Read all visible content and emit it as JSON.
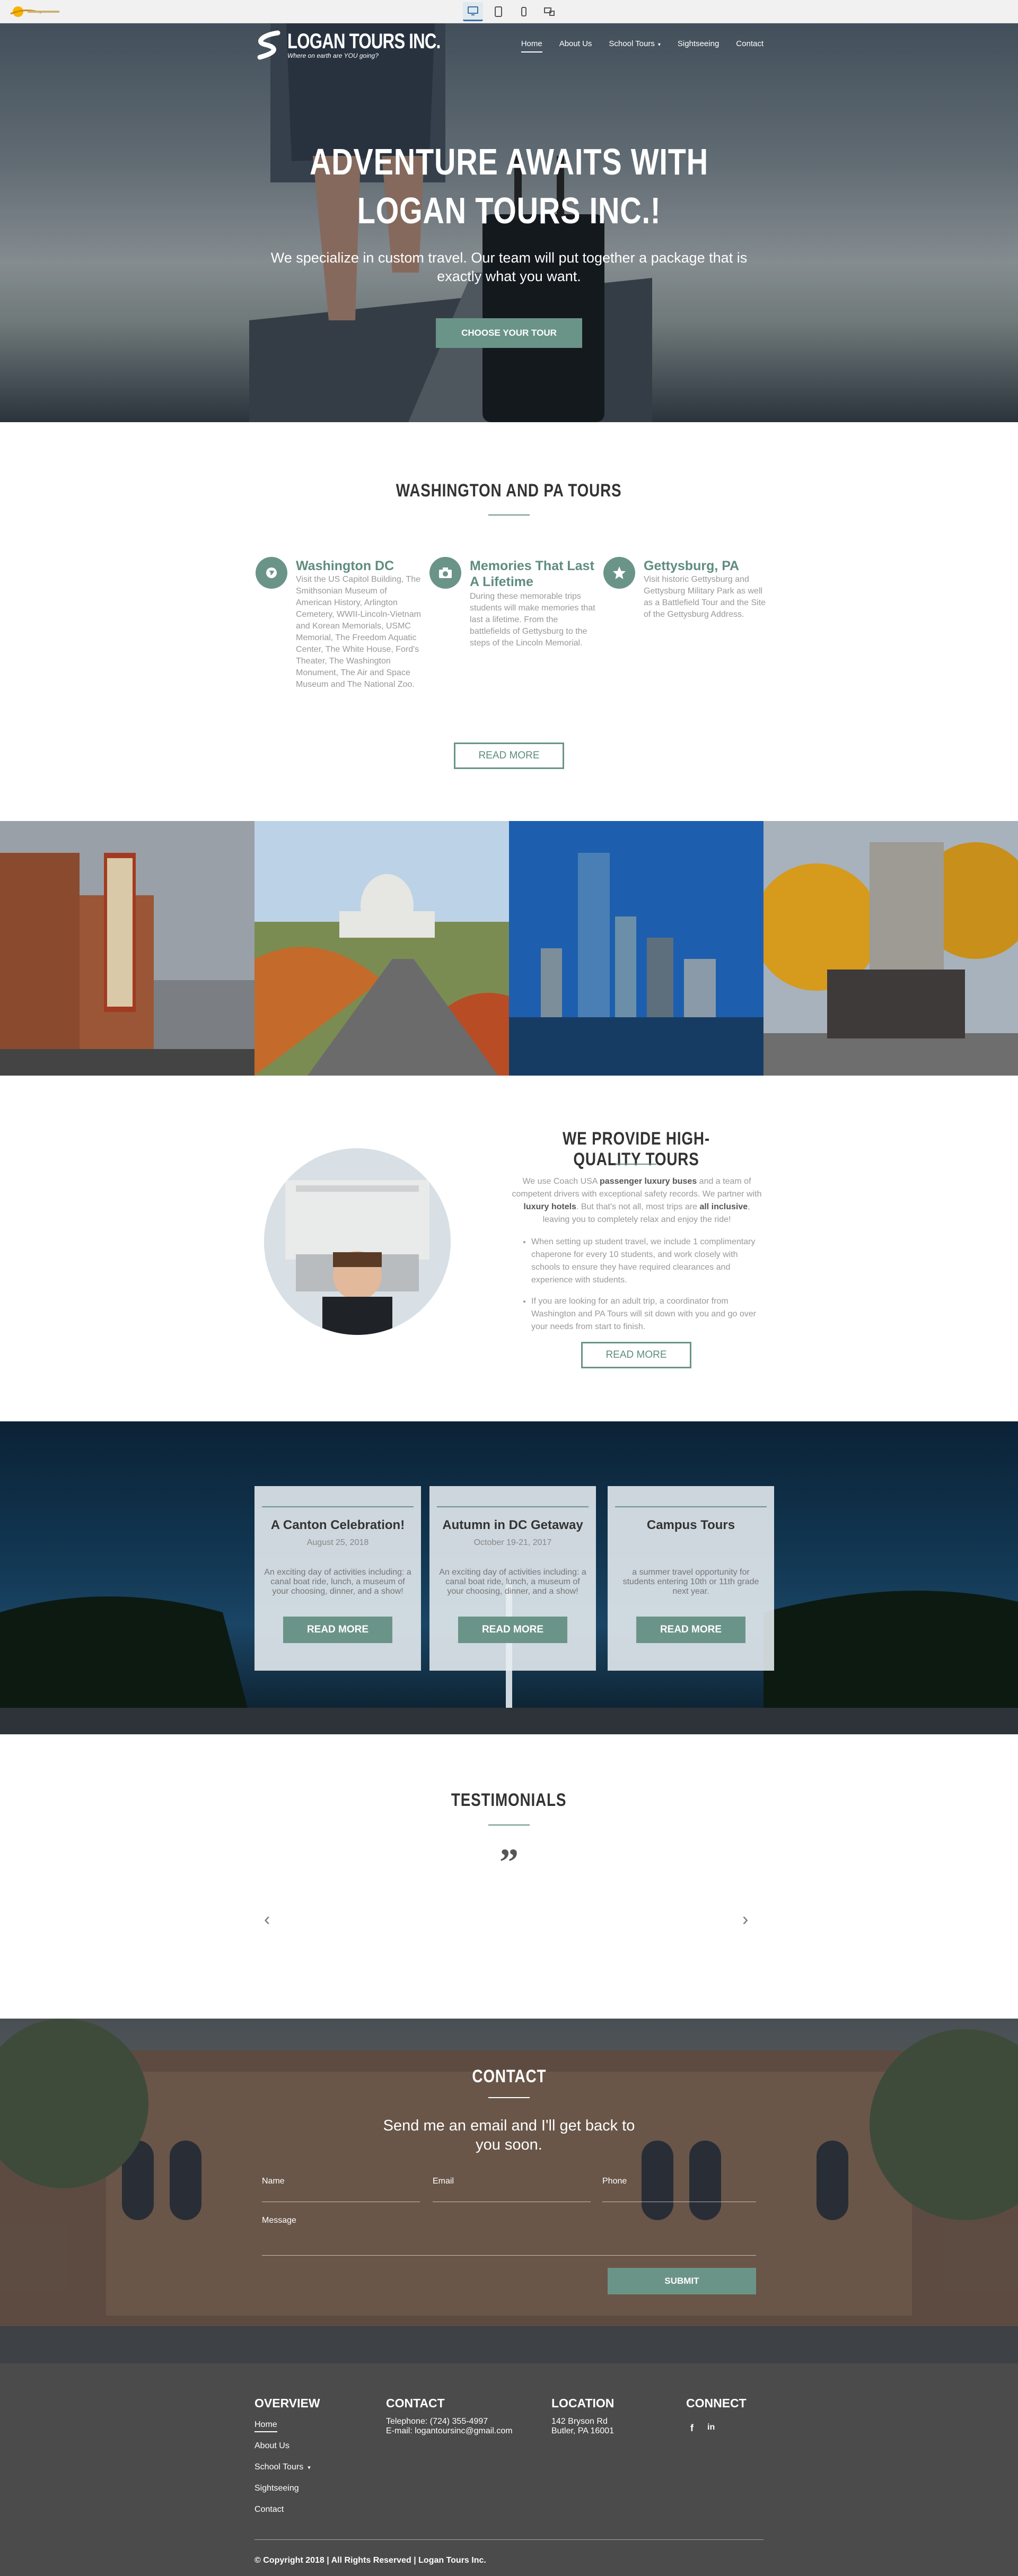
{
  "toolbar": {
    "device_buttons": [
      "desktop",
      "tablet",
      "phone",
      "zoom"
    ]
  },
  "brand": {
    "name": "LOGAN TOURS INC.",
    "tagline": "Where on earth are YOU going?"
  },
  "nav": {
    "items": [
      "Home",
      "About Us",
      "School Tours",
      "Sightseeing",
      "Contact"
    ],
    "active": "Home"
  },
  "hero": {
    "title_line1": "ADVENTURE AWAITS WITH",
    "title_line2": "LOGAN TOURS INC.!",
    "subtitle": "We specialize in custom travel. Our team will put together a package that is exactly what you want.",
    "cta": "CHOOSE YOUR TOUR"
  },
  "tours": {
    "title": "WASHINGTON AND PA TOURS",
    "features": [
      {
        "icon": "globe-icon",
        "title": "Washington DC",
        "text": "Visit the US Capitol Building, The Smithsonian Museum of American History, Arlington Cemetery, WWII-Lincoln-Vietnam and Korean Memorials, USMC Memorial, The Freedom Aquatic Center, The White House, Ford's Theater, The Washington Monument, The Air and Space Museum and The National Zoo."
      },
      {
        "icon": "camera-icon",
        "title": "Memories That Last A Lifetime",
        "text": "During these memorable trips students will make memories that last a lifetime. From the battlefields of Gettysburg to the steps of the Lincoln Memorial."
      },
      {
        "icon": "star-icon",
        "title": "Gettysburg, PA",
        "text": "Visit historic Gettysburg and Gettysburg Military Park as well as a Battlefield Tour and the Site of the Gettysburg Address."
      }
    ],
    "button": "READ MORE"
  },
  "provide": {
    "title": "WE PROVIDE HIGH-QUALITY TOURS",
    "intro_1": "We use Coach USA ",
    "intro_b1": "passenger luxury buses",
    "intro_2": " and a team of competent drivers with exceptional safety records. We partner with ",
    "intro_b2": "luxury hotels",
    "intro_3": ". But that's not all, most trips are ",
    "intro_b3": "all inclusive",
    "intro_4": ", leaving you to completely relax and enjoy the ride!",
    "bullets": [
      "When setting up student travel, we include 1 complimentary chaperone for every 10 students, and work closely with schools to ensure they have required clearances and experience with students.",
      "If you are looking for an adult trip, a coordinator from Washington and PA Tours will sit down with you and go over your needs from start to finish."
    ],
    "button": "READ MORE"
  },
  "events": [
    {
      "title": "A Canton Celebration!",
      "date": "August 25, 2018",
      "desc": "An exciting day of activities including: a canal boat ride, lunch, a museum of your choosing, dinner, and a show!",
      "button": "READ MORE"
    },
    {
      "title": "Autumn in DC Getaway",
      "date": "October 19-21, 2017",
      "desc": "An exciting day of activities including: a canal boat ride, lunch, a museum of your choosing, dinner, and a show!",
      "button": "READ MORE"
    },
    {
      "title": "Campus Tours",
      "date": "",
      "desc": "a summer travel opportunity for students entering 10th or 11th grade next year.",
      "button": "READ MORE"
    }
  ],
  "testimonials": {
    "title": "TESTIMONIALS",
    "quote_mark": "”"
  },
  "contact": {
    "title": "CONTACT",
    "subtitle": "Send me an email and I'll get back to you soon.",
    "fields": {
      "name": "Name",
      "email": "Email",
      "phone": "Phone",
      "message": "Message"
    },
    "submit": "SUBMIT"
  },
  "footer": {
    "overview_title": "OVERVIEW",
    "overview_links": [
      "Home",
      "About Us",
      "School Tours",
      "Sightseeing",
      "Contact"
    ],
    "contact_title": "CONTACT",
    "telephone": "Telephone: (724) 355-4997",
    "email": "E-mail: logantoursinc@gmail.com",
    "location_title": "LOCATION",
    "address_1": "142 Bryson Rd",
    "address_2": "Butler, PA 16001",
    "connect_title": "CONNECT",
    "copyright": "© Copyright 2018 | All Rights Reserved | Logan Tours Inc."
  },
  "colors": {
    "accent": "#6b9489",
    "footer": "#4b4b4b"
  }
}
